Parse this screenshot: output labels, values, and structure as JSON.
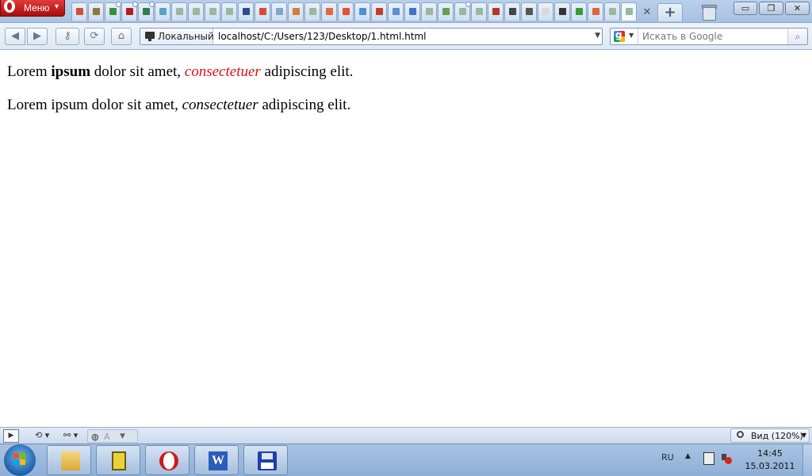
{
  "browser": {
    "menu_label": "Меню",
    "tabs": [
      {
        "fav": "#d44c3c"
      },
      {
        "fav": "#8b7a3c"
      },
      {
        "fav": "#3b8f3b",
        "dot": true
      },
      {
        "fav": "#b02020",
        "dot": true
      },
      {
        "fav": "#2f7d4e",
        "dot": true
      },
      {
        "fav": "#5aa2c8"
      },
      {
        "fav": "#9ab8a0"
      },
      {
        "fav": "#9ab8a0"
      },
      {
        "fav": "#9ab8a0"
      },
      {
        "fav": "#9ab8a0"
      },
      {
        "fav": "#2a4d8c"
      },
      {
        "fav": "#d84a3a"
      },
      {
        "fav": "#7fa6c8"
      },
      {
        "fav": "#d77a3a"
      },
      {
        "fav": "#9ab8a0"
      },
      {
        "fav": "#e06a3a"
      },
      {
        "fav": "#e0533a"
      },
      {
        "fav": "#4f8fd8"
      },
      {
        "fav": "#c43c2c"
      },
      {
        "fav": "#5a8fd0"
      },
      {
        "fav": "#3f73c4"
      },
      {
        "fav": "#9ab8a0"
      },
      {
        "fav": "#6a9e4a"
      },
      {
        "fav": "#9ab8a0",
        "dot": true
      },
      {
        "fav": "#9ab8a0"
      },
      {
        "fav": "#b03a20"
      },
      {
        "fav": "#444444"
      },
      {
        "fav": "#555555"
      },
      {
        "fav": "#d9d9d9"
      },
      {
        "fav": "#333333"
      },
      {
        "fav": "#3a9a3a"
      },
      {
        "fav": "#e0643a"
      },
      {
        "fav": "#9ab8a0"
      },
      {
        "fav": "#9ab8a0",
        "active": true
      }
    ],
    "window_buttons": {
      "minimize": "▭",
      "maximize": "❐",
      "close": "✕"
    },
    "address": {
      "badge": "Локальный",
      "url": "localhost/C:/Users/123/Desktop/1.html.html"
    },
    "search": {
      "placeholder": "Искать в Google"
    },
    "nav": {
      "back": "◀",
      "forward": "▶",
      "reload": "⟳",
      "home": "⌂"
    }
  },
  "page": {
    "p1": {
      "a": "Lorem ",
      "b": "ipsum",
      "c": " dolor sit amet, ",
      "d": "consectetuer",
      "e": " adipiscing elit."
    },
    "p2": {
      "a": "Lorem ipsum dolor sit amet, ",
      "d": "consectetuer",
      "e": " adipiscing elit."
    },
    "accent_color": "#e01010"
  },
  "statusbar": {
    "turbo_label": "A",
    "zoom_label": "Вид (120%)"
  },
  "taskbar": {
    "apps": [
      "explorer",
      "network",
      "opera",
      "word",
      "save"
    ],
    "lang": "RU",
    "time": "14:45",
    "date": "15.03.2011"
  }
}
